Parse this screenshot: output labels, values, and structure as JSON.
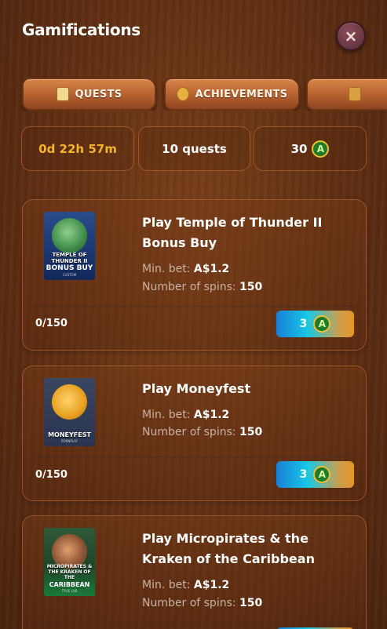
{
  "header": {
    "title": "Gamifications",
    "close_label": "×"
  },
  "tabs": [
    {
      "label": "QUESTS",
      "icon": "quest-scroll-icon"
    },
    {
      "label": "ACHIEVEMENTS",
      "icon": "medal-icon"
    },
    {
      "label": "",
      "icon": "chest-icon"
    }
  ],
  "stats": {
    "timer": "0d 22h 57m",
    "quests": "10 quests",
    "points": "30",
    "coin_symbol": "A",
    "timer_color": "#f7b32b"
  },
  "quests": [
    {
      "title": "Play Temple of Thunder II Bonus Buy",
      "min_bet_label": "Min. bet:",
      "min_bet_value": "A$1.2",
      "spins_label": "Number of spins:",
      "spins_value": "150",
      "progress": "0/150",
      "reward": "3",
      "thumb": {
        "name": "TEMPLE OF THUNDER II",
        "sub": "BONUS BUY",
        "provider": "CUSTOM"
      }
    },
    {
      "title": "Play Moneyfest",
      "min_bet_label": "Min. bet:",
      "min_bet_value": "A$1.2",
      "spins_label": "Number of spins:",
      "spins_value": "150",
      "progress": "0/150",
      "reward": "3",
      "thumb": {
        "name": "MONEYFEST",
        "sub": "",
        "provider": "PORNPLAY"
      }
    },
    {
      "title": "Play Micropirates & the Kraken of the Caribbean",
      "min_bet_label": "Min. bet:",
      "min_bet_value": "A$1.2",
      "spins_label": "Number of spins:",
      "spins_value": "150",
      "progress": "",
      "reward": "",
      "thumb": {
        "name": "MICROPIRATES & THE KRAKEN OF THE",
        "sub": "CARIBBEAN",
        "provider": "TRUE LAB"
      }
    }
  ]
}
